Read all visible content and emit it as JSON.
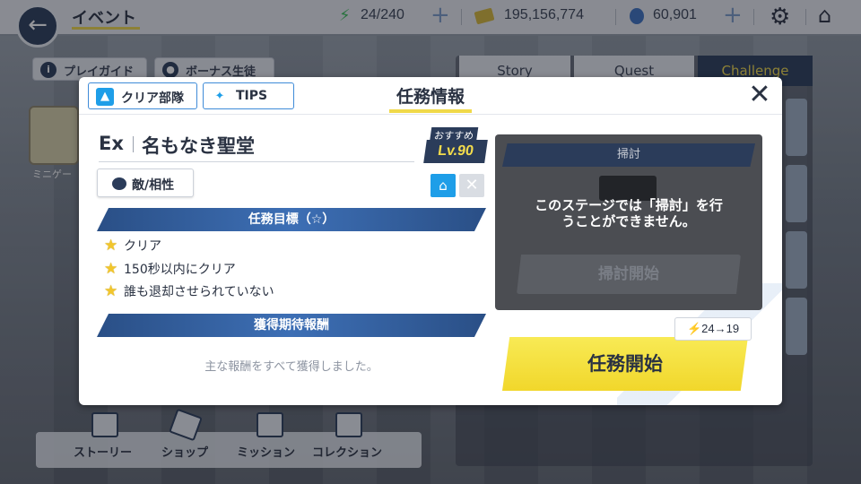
{
  "topbar": {
    "title": "イベント",
    "stamina": "24/240",
    "gold": "195,156,774",
    "gems": "60,901"
  },
  "background": {
    "pill_guide": "プレイガイド",
    "pill_bonus": "ボーナス生徒",
    "tab_story": "Story",
    "tab_quest": "Quest",
    "tab_challenge": "Challenge",
    "mini_label": "ミニゲー",
    "menu": [
      "ストーリー",
      "ショップ",
      "ミッション",
      "コレクション"
    ]
  },
  "modal": {
    "clear_team_label": "クリア部隊",
    "tips_label": "TIPS",
    "title": "任務情報",
    "stage_prefix": "Ex",
    "stage_name": "名もなき聖堂",
    "recommend_label": "おすすめ",
    "recommend_level": "Lv.90",
    "enemy_button": "敵/相性",
    "objectives_header": "任務目標（☆）",
    "objectives": [
      "クリア",
      "150秒以内にクリア",
      "誰も退却させられていない"
    ],
    "rewards_header": "獲得期待報酬",
    "rewards_text": "主な報酬をすべて獲得しました。",
    "sweep_header": "掃討",
    "sweep_message": "このステージでは「掃討」を行うことができません。",
    "sweep_button": "掃討開始",
    "start_button": "任務開始",
    "cost_from": "24",
    "cost_to": "19"
  },
  "colors": {
    "accent_yellow": "#f1d72b",
    "navy": "#2b3c5a",
    "info_blue": "#1e9ee8"
  },
  "icons": [
    "back-arrow-icon",
    "lightning-icon",
    "gold-ticket-icon",
    "gem-icon",
    "gear-icon",
    "home-icon",
    "close-icon",
    "star-icon",
    "house-icon",
    "x-icon",
    "person-icon",
    "bulb-icon"
  ]
}
